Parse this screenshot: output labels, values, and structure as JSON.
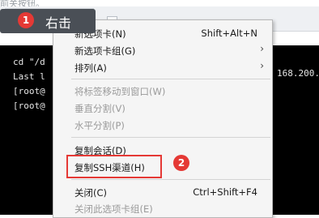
{
  "top_note": "前关按钮。",
  "tab": {
    "chevron": "▾"
  },
  "tooltip": {
    "badge": "1",
    "text": "右击"
  },
  "terminal": {
    "lines": [
      "cd \"/d",
      "Last l",
      "[root@",
      "[root@"
    ],
    "tail": "168.200."
  },
  "menu": {
    "items": [
      {
        "label": "新选项卡(N)",
        "shortcut": "Shift+Alt+N",
        "submenu": false,
        "disabled": false
      },
      {
        "label": "新选项卡组(G)",
        "shortcut": "",
        "submenu": true,
        "disabled": false
      },
      {
        "label": "排列(A)",
        "shortcut": "",
        "submenu": true,
        "disabled": false
      },
      {
        "label": "将标签移动到窗口(W)",
        "shortcut": "",
        "submenu": false,
        "disabled": true
      },
      {
        "label": "垂直分割(V)",
        "shortcut": "",
        "submenu": false,
        "disabled": true
      },
      {
        "label": "水平分割(P)",
        "shortcut": "",
        "submenu": false,
        "disabled": true
      },
      {
        "label": "复制会话(D)",
        "shortcut": "",
        "submenu": false,
        "disabled": false
      },
      {
        "label": "复制SSH渠道(H)",
        "shortcut": "",
        "submenu": false,
        "disabled": false
      },
      {
        "label": "关闭(C)",
        "shortcut": "Ctrl+Shift+F4",
        "submenu": false,
        "disabled": false
      },
      {
        "label": "关闭此选项卡组(E)",
        "shortcut": "",
        "submenu": false,
        "disabled": true
      }
    ],
    "submenu_arrow": "›"
  },
  "annotation": {
    "badge": "2"
  },
  "colors": {
    "annotation_red": "#e53935",
    "terminal_bg": "#000000",
    "tooltip_bg": "#4a4f56",
    "tab_status": "#1ea1e6"
  }
}
